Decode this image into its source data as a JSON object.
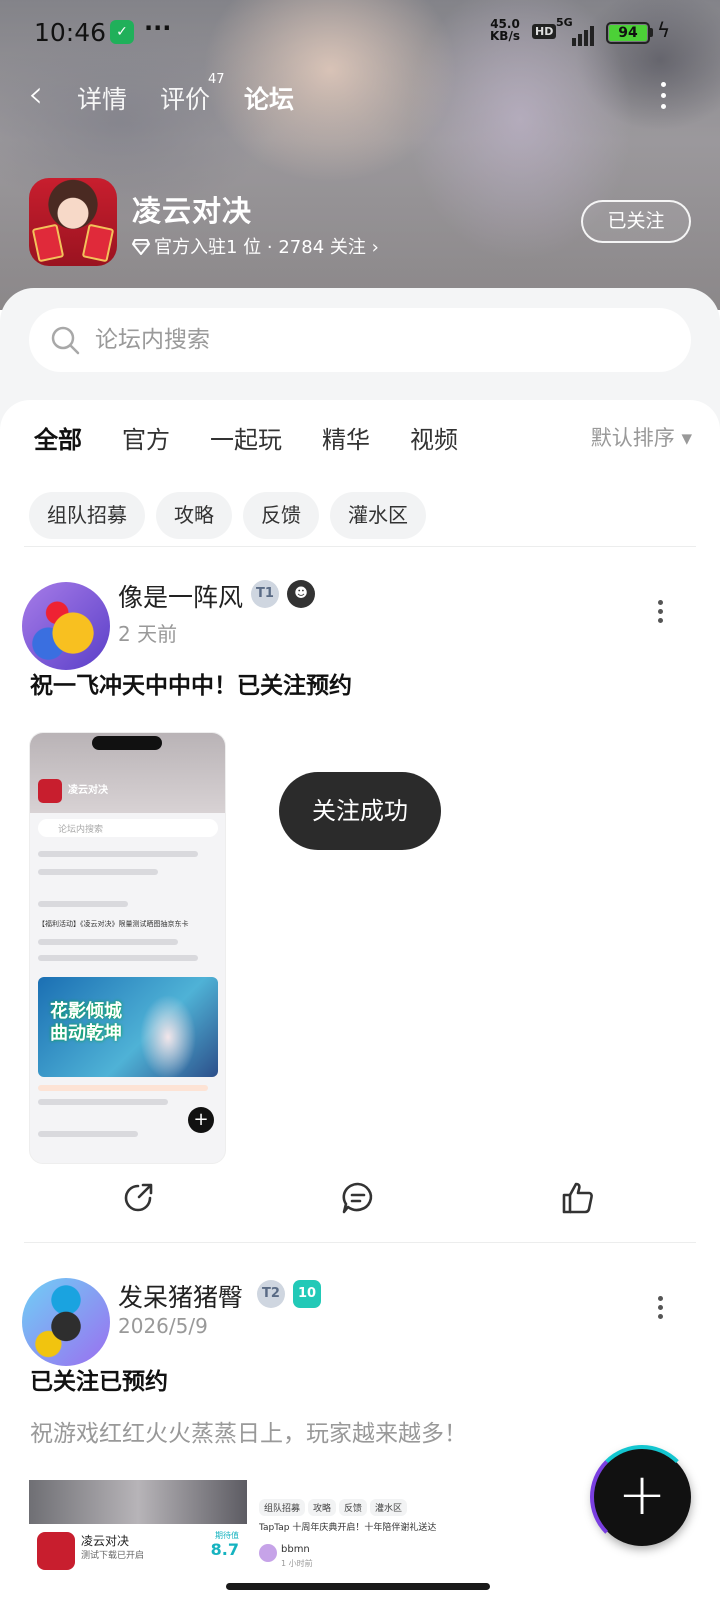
{
  "status_bar": {
    "time": "10:46",
    "speed_value": "45.0",
    "speed_unit": "KB/s",
    "hd": "HD",
    "network": "5G",
    "battery": "94"
  },
  "nav": {
    "tabs": [
      {
        "label": "详情"
      },
      {
        "label": "评价",
        "count": "47"
      },
      {
        "label": "论坛"
      }
    ]
  },
  "game": {
    "name": "凌云对决",
    "meta": "官方入驻1 位 · 2784 关注 ›",
    "follow_label": "已关注"
  },
  "search": {
    "placeholder": "论坛内搜索"
  },
  "filter_tabs": [
    "全部",
    "官方",
    "一起玩",
    "精华",
    "视频"
  ],
  "sort_label": "默认排序 ▾",
  "chips": [
    "组队招募",
    "攻略",
    "反馈",
    "灌水区"
  ],
  "posts": [
    {
      "username": "像是一阵风",
      "badge_level": "1",
      "time": "2 天前",
      "title": "祝一飞冲天中中中！已关注预约",
      "screenshot": {
        "app_name": "凌云对决",
        "search_placeholder": "论坛内搜索",
        "banner_text": "花影倾城 曲动乾坤",
        "post_title": "【福利活动】《凌云对决》限量测试晒图抽京东卡"
      }
    },
    {
      "username": "发呆猪猪臀",
      "badge_level": "2",
      "badge_extra": "10",
      "time": "2026/5/9",
      "title": "已关注已预约",
      "body": "祝游戏红红火火蒸蒸日上，玩家越来越多！",
      "left_image": {
        "app_name": "凌云对决",
        "subtitle": "测试下载已开启",
        "score_label": "期待值",
        "score": "8.7"
      },
      "right_image": {
        "chips": [
          "组队招募",
          "攻略",
          "反馈",
          "灌水区"
        ],
        "line": "TapTap 十周年庆典开启！十年陪伴谢礼送达",
        "name": "bbmn",
        "time": "1 小时前"
      }
    }
  ],
  "toast": "关注成功",
  "fab": "+"
}
